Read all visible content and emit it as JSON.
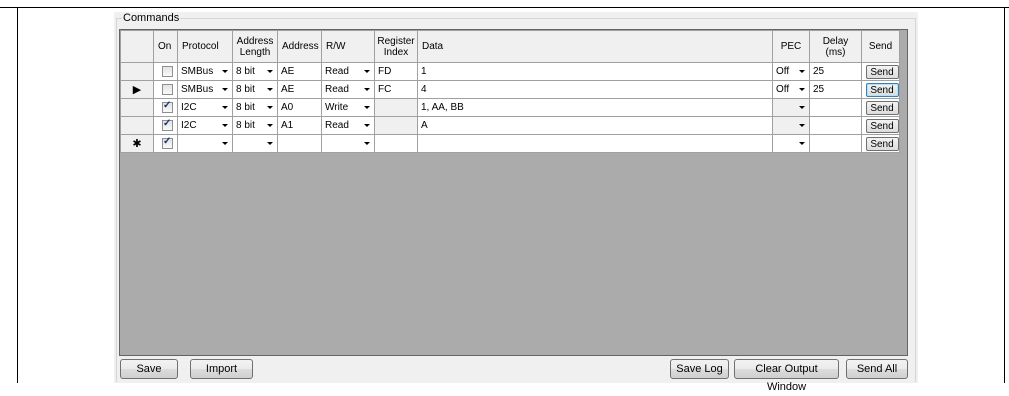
{
  "group": {
    "title": "Commands"
  },
  "columns": {
    "on": "On",
    "protocol": "Protocol",
    "address_length": [
      "Address",
      "Length"
    ],
    "address": "Address",
    "rw": "R/W",
    "register_index": [
      "Register",
      "Index"
    ],
    "data": "Data",
    "pec": "PEC",
    "delay": [
      "Delay",
      "(ms)"
    ],
    "send": "Send"
  },
  "rows": [
    {
      "marker": "",
      "on": false,
      "protocol": "SMBus",
      "addr_len": "8 bit",
      "address": "AE",
      "rw": "Read",
      "reg_index": "FD",
      "data": "1",
      "pec": "Off",
      "delay": "25",
      "send": "Send"
    },
    {
      "marker": "▶",
      "on": false,
      "protocol": "SMBus",
      "addr_len": "8 bit",
      "address": "AE",
      "rw": "Read",
      "reg_index": "FC",
      "data": "4",
      "pec": "Off",
      "delay": "25",
      "send": "Send"
    },
    {
      "marker": "",
      "on": true,
      "protocol": "I2C",
      "addr_len": "8 bit",
      "address": "A0",
      "rw": "Write",
      "reg_index": "",
      "data": "1, AA, BB",
      "pec": "",
      "delay": "",
      "send": "Send"
    },
    {
      "marker": "",
      "on": true,
      "protocol": "I2C",
      "addr_len": "8 bit",
      "address": "A1",
      "rw": "Read",
      "reg_index": "",
      "data": "A",
      "pec": "",
      "delay": "",
      "send": "Send"
    },
    {
      "marker": "✱",
      "on": true,
      "protocol": "",
      "addr_len": "",
      "address": "",
      "rw": "",
      "reg_index": "",
      "data": "",
      "pec": "",
      "delay": "",
      "send": "Send"
    }
  ],
  "buttons": {
    "save": "Save",
    "import": "Import",
    "save_log": "Save Log",
    "clear_output": "Clear Output Window",
    "send_all": "Send All"
  }
}
